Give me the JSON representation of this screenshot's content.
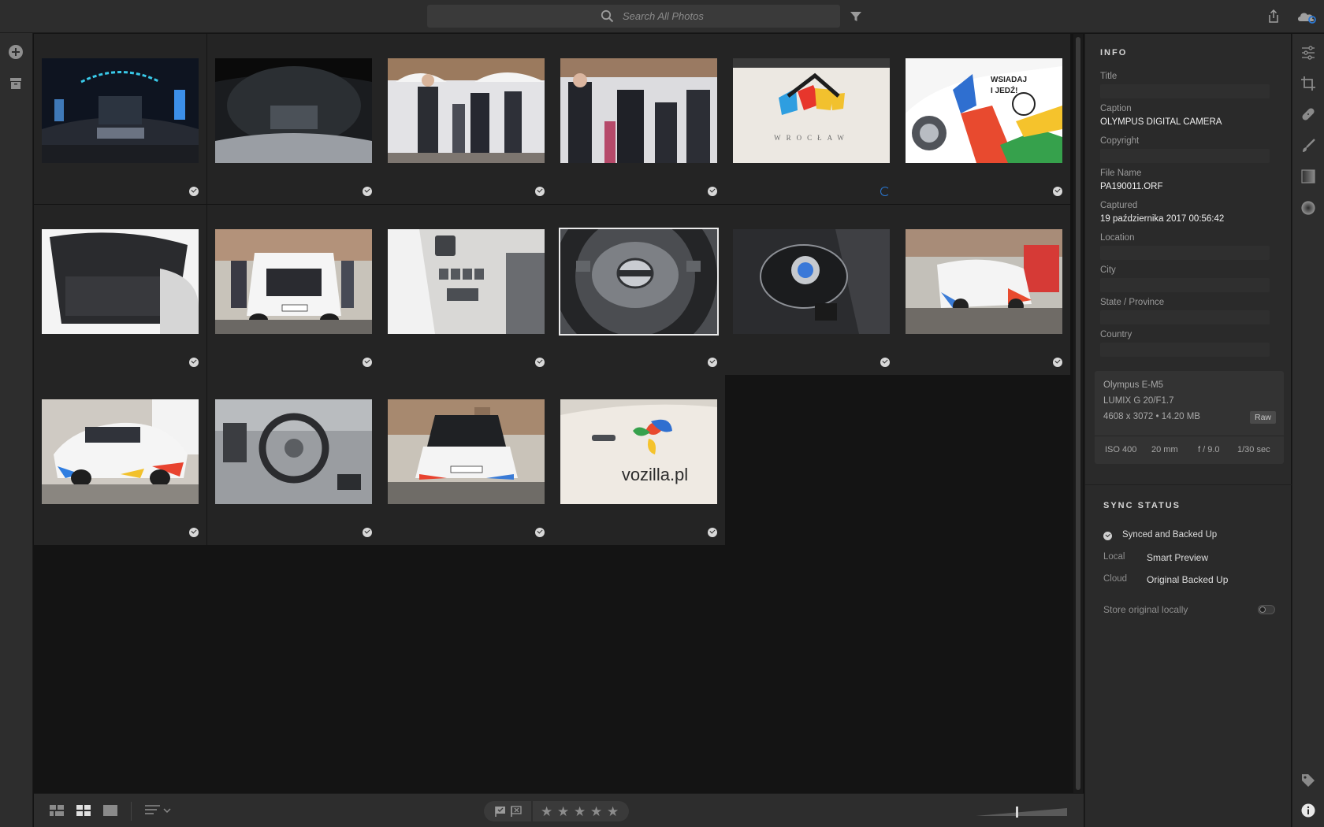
{
  "search": {
    "placeholder": "Search All Photos"
  },
  "info": {
    "title": "INFO",
    "fields": {
      "title_label": "Title",
      "caption_label": "Caption",
      "caption_value": "OLYMPUS DIGITAL CAMERA",
      "copyright_label": "Copyright",
      "filename_label": "File Name",
      "filename_value": "PA190011.ORF",
      "captured_label": "Captured",
      "captured_value": "19 października 2017 00:56:42",
      "location_label": "Location",
      "city_label": "City",
      "state_label": "State / Province",
      "country_label": "Country"
    },
    "camera": {
      "model": "Olympus E-M5",
      "lens": "LUMIX G 20/F1.7",
      "dimensions": "4608 x 3072  •  14.20 MB",
      "format": "Raw",
      "iso": "ISO 400",
      "focal": "20 mm",
      "aperture": "f / 9.0",
      "shutter": "1/30 sec"
    }
  },
  "sync": {
    "title": "SYNC STATUS",
    "status": "Synced and Backed Up",
    "local_label": "Local",
    "local_value": "Smart Preview",
    "cloud_label": "Cloud",
    "cloud_value": "Original Backed Up",
    "store_label": "Store original locally"
  },
  "thumbnails": [
    {
      "name": "dashboard-display",
      "status": "synced"
    },
    {
      "name": "instrument-cluster",
      "status": "synced"
    },
    {
      "name": "press-event-group",
      "status": "synced"
    },
    {
      "name": "speaker-microphone",
      "status": "synced"
    },
    {
      "name": "wroclaw-logo-hood",
      "status": "syncing"
    },
    {
      "name": "vozilla-car-door",
      "status": "synced"
    },
    {
      "name": "open-trunk-interior",
      "status": "synced"
    },
    {
      "name": "car-rear-open-hatch",
      "status": "synced"
    },
    {
      "name": "dashboard-buttons",
      "status": "synced"
    },
    {
      "name": "nissan-steering-wheel",
      "status": "synced",
      "selected": true
    },
    {
      "name": "gear-selector",
      "status": "synced"
    },
    {
      "name": "white-car-square",
      "status": "synced"
    },
    {
      "name": "car-front-side",
      "status": "synced"
    },
    {
      "name": "interior-steering",
      "status": "synced"
    },
    {
      "name": "car-hood-open",
      "status": "synced"
    },
    {
      "name": "vozilla-pl-logo",
      "status": "synced"
    }
  ],
  "rating": {
    "stars": [
      "★",
      "★",
      "★",
      "★",
      "★"
    ]
  },
  "colors": {
    "accent": "#2a78d4",
    "panel": "#2a2a2a",
    "background": "#141414"
  }
}
